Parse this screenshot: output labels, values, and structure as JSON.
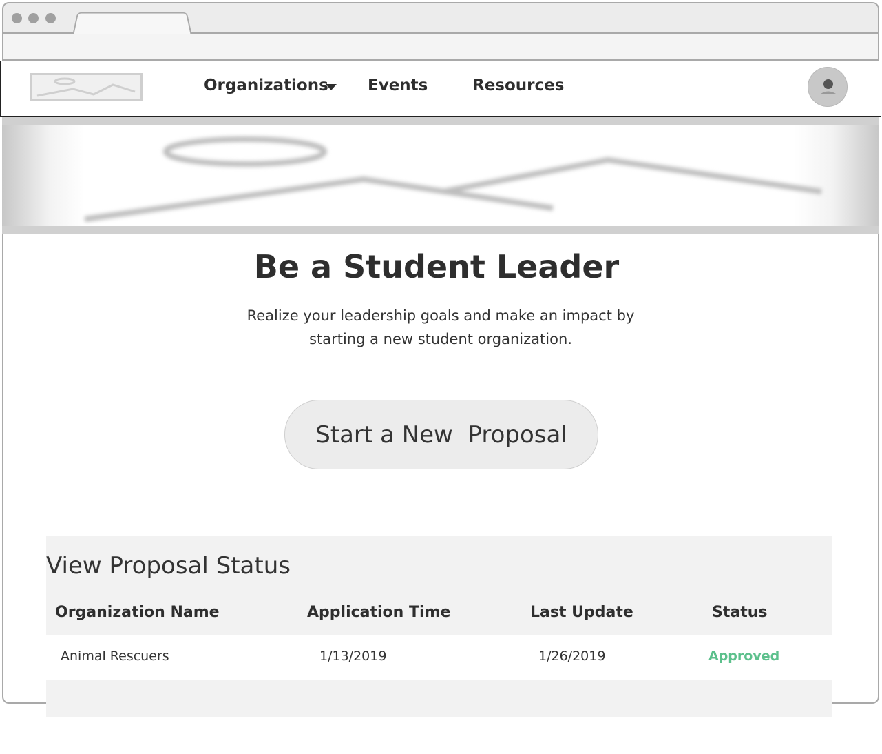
{
  "nav": {
    "items": [
      {
        "label": "Organizations",
        "has_dropdown": true
      },
      {
        "label": "Events"
      },
      {
        "label": "Resources"
      }
    ]
  },
  "hero": {
    "title": "Be a Student Leader",
    "subtitle": "Realize your leadership goals and make an impact by starting a new student organization.",
    "cta_label": "Start a New  Proposal"
  },
  "proposals": {
    "title": "View Proposal Status",
    "columns": [
      "Organization Name",
      "Application Time",
      "Last Update",
      "Status"
    ],
    "rows": [
      {
        "name": "Animal Rescuers",
        "applied": "1/13/2019",
        "updated": "1/26/2019",
        "status": "Approved"
      }
    ]
  },
  "colors": {
    "approved": "#5cc08c",
    "panel_bg": "#f2f2f2"
  }
}
